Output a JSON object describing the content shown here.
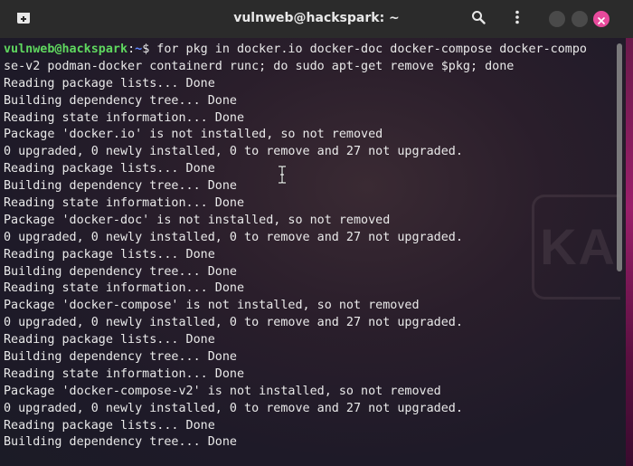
{
  "window": {
    "title": "vulnweb@hackspark: ~"
  },
  "titlebar": {
    "new_tab_icon": "new-tab-icon",
    "search_icon": "search-icon",
    "menu_icon": "kebab-menu-icon",
    "colors": {
      "close": "#e84a9c",
      "minmax": "#4a4a4a",
      "bar": "#2b2b2b"
    }
  },
  "terminal": {
    "prompt": {
      "user_host": "vulnweb@hackspark",
      "separator": ":",
      "path": "~",
      "symbol": "$"
    },
    "command_line_1": " for pkg in docker.io docker-doc docker-compose docker-compo",
    "command_line_2": "se-v2 podman-docker containerd runc; do sudo apt-get remove $pkg; done",
    "output": [
      "Reading package lists... Done",
      "Building dependency tree... Done",
      "Reading state information... Done",
      "Package 'docker.io' is not installed, so not removed",
      "0 upgraded, 0 newly installed, 0 to remove and 27 not upgraded.",
      "Reading package lists... Done",
      "Building dependency tree... Done",
      "Reading state information... Done",
      "Package 'docker-doc' is not installed, so not removed",
      "0 upgraded, 0 newly installed, 0 to remove and 27 not upgraded.",
      "Reading package lists... Done",
      "Building dependency tree... Done",
      "Reading state information... Done",
      "Package 'docker-compose' is not installed, so not removed",
      "0 upgraded, 0 newly installed, 0 to remove and 27 not upgraded.",
      "Reading package lists... Done",
      "Building dependency tree... Done",
      "Reading state information... Done",
      "Package 'docker-compose-v2' is not installed, so not removed",
      "0 upgraded, 0 newly installed, 0 to remove and 27 not upgraded.",
      "Reading package lists... Done",
      "Building dependency tree... Done"
    ],
    "colors": {
      "text": "#e9e9e9",
      "user_host": "#5fd75f",
      "path": "#5f87ff"
    }
  }
}
